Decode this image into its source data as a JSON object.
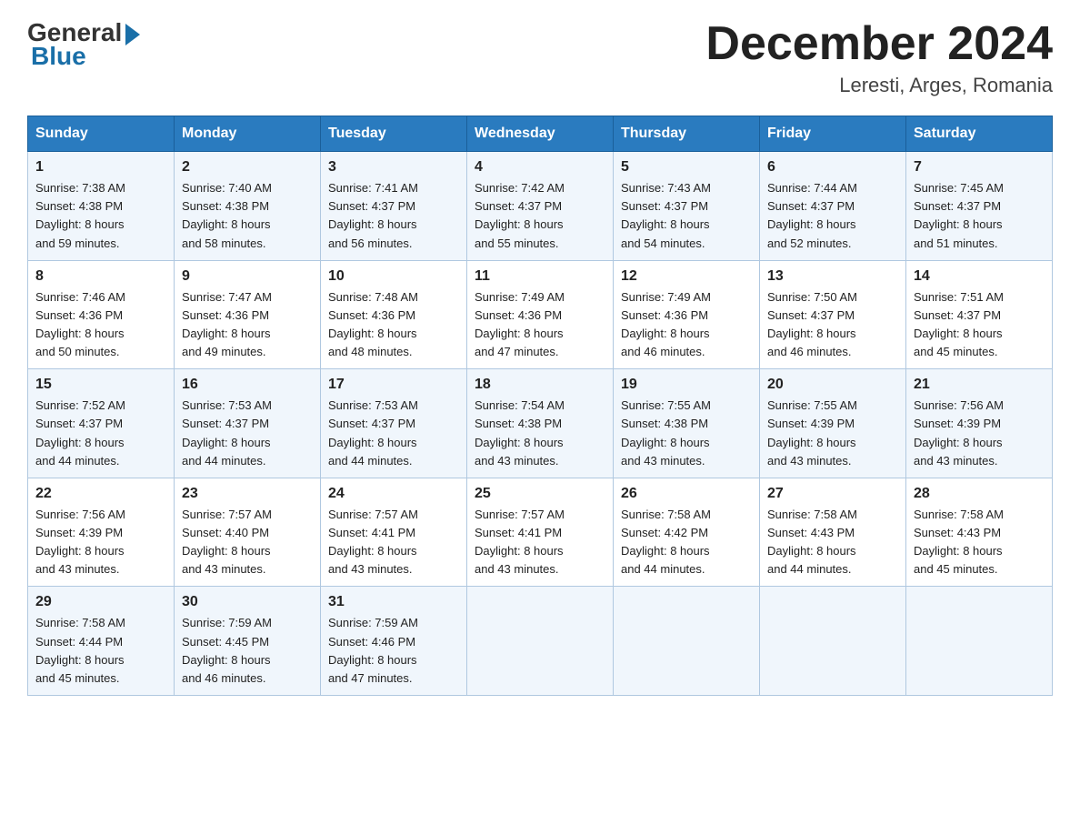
{
  "header": {
    "logo_general": "General",
    "logo_blue": "Blue",
    "month_title": "December 2024",
    "location": "Leresti, Arges, Romania"
  },
  "days_of_week": [
    "Sunday",
    "Monday",
    "Tuesday",
    "Wednesday",
    "Thursday",
    "Friday",
    "Saturday"
  ],
  "weeks": [
    [
      {
        "num": "1",
        "sunrise": "7:38 AM",
        "sunset": "4:38 PM",
        "daylight": "8 hours and 59 minutes."
      },
      {
        "num": "2",
        "sunrise": "7:40 AM",
        "sunset": "4:38 PM",
        "daylight": "8 hours and 58 minutes."
      },
      {
        "num": "3",
        "sunrise": "7:41 AM",
        "sunset": "4:37 PM",
        "daylight": "8 hours and 56 minutes."
      },
      {
        "num": "4",
        "sunrise": "7:42 AM",
        "sunset": "4:37 PM",
        "daylight": "8 hours and 55 minutes."
      },
      {
        "num": "5",
        "sunrise": "7:43 AM",
        "sunset": "4:37 PM",
        "daylight": "8 hours and 54 minutes."
      },
      {
        "num": "6",
        "sunrise": "7:44 AM",
        "sunset": "4:37 PM",
        "daylight": "8 hours and 52 minutes."
      },
      {
        "num": "7",
        "sunrise": "7:45 AM",
        "sunset": "4:37 PM",
        "daylight": "8 hours and 51 minutes."
      }
    ],
    [
      {
        "num": "8",
        "sunrise": "7:46 AM",
        "sunset": "4:36 PM",
        "daylight": "8 hours and 50 minutes."
      },
      {
        "num": "9",
        "sunrise": "7:47 AM",
        "sunset": "4:36 PM",
        "daylight": "8 hours and 49 minutes."
      },
      {
        "num": "10",
        "sunrise": "7:48 AM",
        "sunset": "4:36 PM",
        "daylight": "8 hours and 48 minutes."
      },
      {
        "num": "11",
        "sunrise": "7:49 AM",
        "sunset": "4:36 PM",
        "daylight": "8 hours and 47 minutes."
      },
      {
        "num": "12",
        "sunrise": "7:49 AM",
        "sunset": "4:36 PM",
        "daylight": "8 hours and 46 minutes."
      },
      {
        "num": "13",
        "sunrise": "7:50 AM",
        "sunset": "4:37 PM",
        "daylight": "8 hours and 46 minutes."
      },
      {
        "num": "14",
        "sunrise": "7:51 AM",
        "sunset": "4:37 PM",
        "daylight": "8 hours and 45 minutes."
      }
    ],
    [
      {
        "num": "15",
        "sunrise": "7:52 AM",
        "sunset": "4:37 PM",
        "daylight": "8 hours and 44 minutes."
      },
      {
        "num": "16",
        "sunrise": "7:53 AM",
        "sunset": "4:37 PM",
        "daylight": "8 hours and 44 minutes."
      },
      {
        "num": "17",
        "sunrise": "7:53 AM",
        "sunset": "4:37 PM",
        "daylight": "8 hours and 44 minutes."
      },
      {
        "num": "18",
        "sunrise": "7:54 AM",
        "sunset": "4:38 PM",
        "daylight": "8 hours and 43 minutes."
      },
      {
        "num": "19",
        "sunrise": "7:55 AM",
        "sunset": "4:38 PM",
        "daylight": "8 hours and 43 minutes."
      },
      {
        "num": "20",
        "sunrise": "7:55 AM",
        "sunset": "4:39 PM",
        "daylight": "8 hours and 43 minutes."
      },
      {
        "num": "21",
        "sunrise": "7:56 AM",
        "sunset": "4:39 PM",
        "daylight": "8 hours and 43 minutes."
      }
    ],
    [
      {
        "num": "22",
        "sunrise": "7:56 AM",
        "sunset": "4:39 PM",
        "daylight": "8 hours and 43 minutes."
      },
      {
        "num": "23",
        "sunrise": "7:57 AM",
        "sunset": "4:40 PM",
        "daylight": "8 hours and 43 minutes."
      },
      {
        "num": "24",
        "sunrise": "7:57 AM",
        "sunset": "4:41 PM",
        "daylight": "8 hours and 43 minutes."
      },
      {
        "num": "25",
        "sunrise": "7:57 AM",
        "sunset": "4:41 PM",
        "daylight": "8 hours and 43 minutes."
      },
      {
        "num": "26",
        "sunrise": "7:58 AM",
        "sunset": "4:42 PM",
        "daylight": "8 hours and 44 minutes."
      },
      {
        "num": "27",
        "sunrise": "7:58 AM",
        "sunset": "4:43 PM",
        "daylight": "8 hours and 44 minutes."
      },
      {
        "num": "28",
        "sunrise": "7:58 AM",
        "sunset": "4:43 PM",
        "daylight": "8 hours and 45 minutes."
      }
    ],
    [
      {
        "num": "29",
        "sunrise": "7:58 AM",
        "sunset": "4:44 PM",
        "daylight": "8 hours and 45 minutes."
      },
      {
        "num": "30",
        "sunrise": "7:59 AM",
        "sunset": "4:45 PM",
        "daylight": "8 hours and 46 minutes."
      },
      {
        "num": "31",
        "sunrise": "7:59 AM",
        "sunset": "4:46 PM",
        "daylight": "8 hours and 47 minutes."
      },
      null,
      null,
      null,
      null
    ]
  ],
  "labels": {
    "sunrise": "Sunrise:",
    "sunset": "Sunset:",
    "daylight": "Daylight:"
  }
}
